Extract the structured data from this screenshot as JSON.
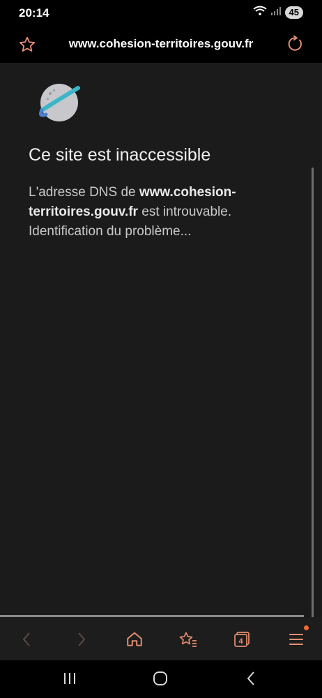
{
  "status": {
    "time": "20:14",
    "battery": "45"
  },
  "browser": {
    "url": "www.cohesion-territoires.gouv.fr",
    "tab_count": "4"
  },
  "error": {
    "title": "Ce site est inaccessible",
    "desc_prefix": "L'adresse DNS de ",
    "desc_host": "www.cohesion-territoires.gouv.fr",
    "desc_suffix": " est introuvable.",
    "desc_line2": "Identification du problème..."
  },
  "icons": {
    "favorite": "star-icon",
    "reload": "reload-icon",
    "back": "chevron-left-icon",
    "forward": "chevron-right-icon",
    "home": "home-icon",
    "bookmarks": "star-list-icon",
    "tabs": "tabs-icon",
    "menu": "menu-icon"
  },
  "colors": {
    "accent": "#e58f72",
    "background": "#1b1b1b",
    "notification": "#f26a2e"
  }
}
